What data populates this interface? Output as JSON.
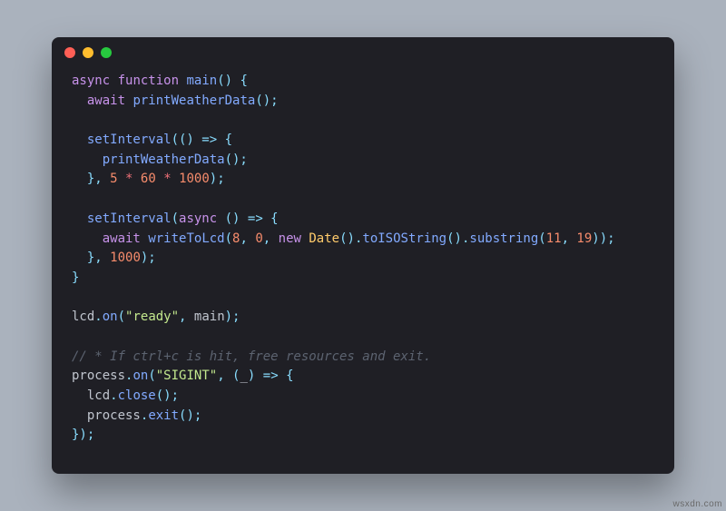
{
  "colors": {
    "page_bg": "#aab2bd",
    "window_bg": "#1f1f25",
    "close": "#ff5f56",
    "minimize": "#ffbd2e",
    "maximize": "#27c93f"
  },
  "watermark": "wsxdn.com",
  "code": {
    "tokens": [
      {
        "t": "kw",
        "v": "async"
      },
      {
        "t": "sp",
        "v": " "
      },
      {
        "t": "kw",
        "v": "function"
      },
      {
        "t": "sp",
        "v": " "
      },
      {
        "t": "fn",
        "v": "main"
      },
      {
        "t": "punc",
        "v": "()"
      },
      {
        "t": "sp",
        "v": " "
      },
      {
        "t": "punc",
        "v": "{"
      },
      {
        "t": "nl",
        "v": "\n"
      },
      {
        "t": "sp",
        "v": "  "
      },
      {
        "t": "kw",
        "v": "await"
      },
      {
        "t": "sp",
        "v": " "
      },
      {
        "t": "fn",
        "v": "printWeatherData"
      },
      {
        "t": "punc",
        "v": "();"
      },
      {
        "t": "nl",
        "v": "\n"
      },
      {
        "t": "nl",
        "v": "\n"
      },
      {
        "t": "sp",
        "v": "  "
      },
      {
        "t": "fn",
        "v": "setInterval"
      },
      {
        "t": "punc",
        "v": "(() => {"
      },
      {
        "t": "nl",
        "v": "\n"
      },
      {
        "t": "sp",
        "v": "    "
      },
      {
        "t": "fn",
        "v": "printWeatherData"
      },
      {
        "t": "punc",
        "v": "();"
      },
      {
        "t": "nl",
        "v": "\n"
      },
      {
        "t": "sp",
        "v": "  "
      },
      {
        "t": "punc",
        "v": "}, "
      },
      {
        "t": "num",
        "v": "5"
      },
      {
        "t": "sp",
        "v": " "
      },
      {
        "t": "op",
        "v": "*"
      },
      {
        "t": "sp",
        "v": " "
      },
      {
        "t": "num",
        "v": "60"
      },
      {
        "t": "sp",
        "v": " "
      },
      {
        "t": "op",
        "v": "*"
      },
      {
        "t": "sp",
        "v": " "
      },
      {
        "t": "num",
        "v": "1000"
      },
      {
        "t": "punc",
        "v": ");"
      },
      {
        "t": "nl",
        "v": "\n"
      },
      {
        "t": "nl",
        "v": "\n"
      },
      {
        "t": "sp",
        "v": "  "
      },
      {
        "t": "fn",
        "v": "setInterval"
      },
      {
        "t": "punc",
        "v": "("
      },
      {
        "t": "kw",
        "v": "async"
      },
      {
        "t": "sp",
        "v": " "
      },
      {
        "t": "punc",
        "v": "() => {"
      },
      {
        "t": "nl",
        "v": "\n"
      },
      {
        "t": "sp",
        "v": "    "
      },
      {
        "t": "kw",
        "v": "await"
      },
      {
        "t": "sp",
        "v": " "
      },
      {
        "t": "fn",
        "v": "writeToLcd"
      },
      {
        "t": "punc",
        "v": "("
      },
      {
        "t": "num",
        "v": "8"
      },
      {
        "t": "punc",
        "v": ", "
      },
      {
        "t": "num",
        "v": "0"
      },
      {
        "t": "punc",
        "v": ", "
      },
      {
        "t": "kw",
        "v": "new"
      },
      {
        "t": "sp",
        "v": " "
      },
      {
        "t": "cls",
        "v": "Date"
      },
      {
        "t": "punc",
        "v": "()."
      },
      {
        "t": "fn",
        "v": "toISOString"
      },
      {
        "t": "punc",
        "v": "()."
      },
      {
        "t": "fn",
        "v": "substring"
      },
      {
        "t": "punc",
        "v": "("
      },
      {
        "t": "num",
        "v": "11"
      },
      {
        "t": "punc",
        "v": ", "
      },
      {
        "t": "num",
        "v": "19"
      },
      {
        "t": "punc",
        "v": "));"
      },
      {
        "t": "nl",
        "v": "\n"
      },
      {
        "t": "sp",
        "v": "  "
      },
      {
        "t": "punc",
        "v": "}, "
      },
      {
        "t": "num",
        "v": "1000"
      },
      {
        "t": "punc",
        "v": ");"
      },
      {
        "t": "nl",
        "v": "\n"
      },
      {
        "t": "punc",
        "v": "}"
      },
      {
        "t": "nl",
        "v": "\n"
      },
      {
        "t": "nl",
        "v": "\n"
      },
      {
        "t": "id",
        "v": "lcd"
      },
      {
        "t": "punc",
        "v": "."
      },
      {
        "t": "fn",
        "v": "on"
      },
      {
        "t": "punc",
        "v": "("
      },
      {
        "t": "str",
        "v": "\"ready\""
      },
      {
        "t": "punc",
        "v": ", "
      },
      {
        "t": "id",
        "v": "main"
      },
      {
        "t": "punc",
        "v": ");"
      },
      {
        "t": "nl",
        "v": "\n"
      },
      {
        "t": "nl",
        "v": "\n"
      },
      {
        "t": "cmt",
        "v": "// * If ctrl+c is hit, free resources and exit."
      },
      {
        "t": "nl",
        "v": "\n"
      },
      {
        "t": "id",
        "v": "process"
      },
      {
        "t": "punc",
        "v": "."
      },
      {
        "t": "fn",
        "v": "on"
      },
      {
        "t": "punc",
        "v": "("
      },
      {
        "t": "str",
        "v": "\"SIGINT\""
      },
      {
        "t": "punc",
        "v": ", ("
      },
      {
        "t": "id",
        "v": "_"
      },
      {
        "t": "punc",
        "v": ") => {"
      },
      {
        "t": "nl",
        "v": "\n"
      },
      {
        "t": "sp",
        "v": "  "
      },
      {
        "t": "id",
        "v": "lcd"
      },
      {
        "t": "punc",
        "v": "."
      },
      {
        "t": "fn",
        "v": "close"
      },
      {
        "t": "punc",
        "v": "();"
      },
      {
        "t": "nl",
        "v": "\n"
      },
      {
        "t": "sp",
        "v": "  "
      },
      {
        "t": "id",
        "v": "process"
      },
      {
        "t": "punc",
        "v": "."
      },
      {
        "t": "fn",
        "v": "exit"
      },
      {
        "t": "punc",
        "v": "();"
      },
      {
        "t": "nl",
        "v": "\n"
      },
      {
        "t": "punc",
        "v": "});"
      }
    ]
  }
}
